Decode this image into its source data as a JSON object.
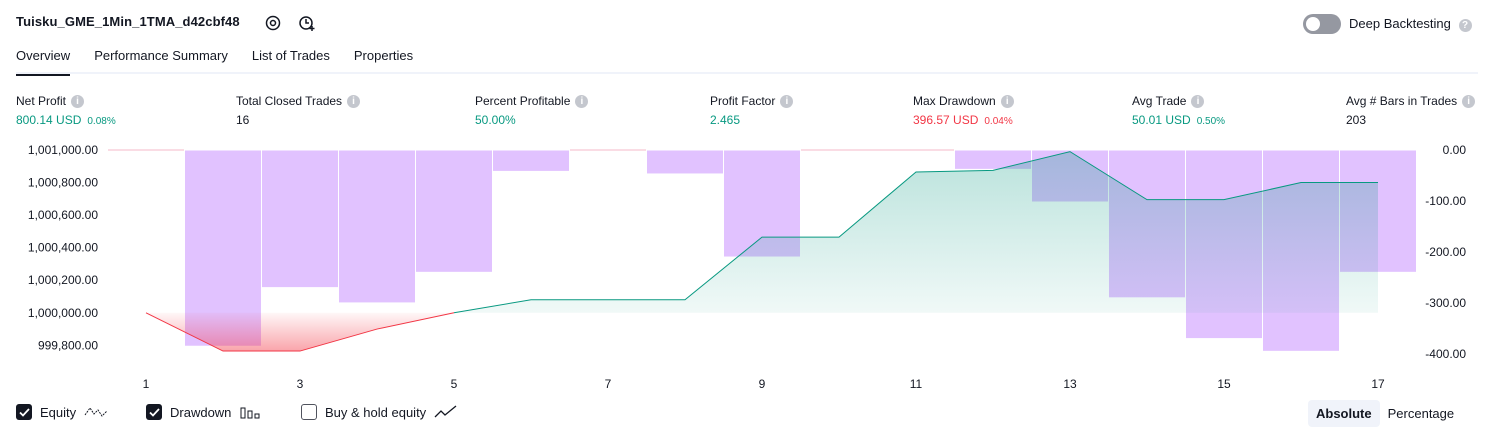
{
  "header": {
    "title": "Tuisku_GME_1Min_1TMA_d42cbf48",
    "deep_backtesting_label": "Deep Backtesting"
  },
  "tabs": [
    "Overview",
    "Performance Summary",
    "List of Trades",
    "Properties"
  ],
  "metrics": {
    "net_profit": {
      "label": "Net Profit",
      "value": "800.14 USD",
      "pct": "0.08%"
    },
    "total_closed_trades": {
      "label": "Total Closed Trades",
      "value": "16"
    },
    "percent_profitable": {
      "label": "Percent Profitable",
      "value": "50.00%"
    },
    "profit_factor": {
      "label": "Profit Factor",
      "value": "2.465"
    },
    "max_drawdown": {
      "label": "Max Drawdown",
      "value": "396.57 USD",
      "pct": "0.04%"
    },
    "avg_trade": {
      "label": "Avg Trade",
      "value": "50.01 USD",
      "pct": "0.50%"
    },
    "avg_bars": {
      "label": "Avg # Bars in Trades",
      "value": "203"
    }
  },
  "legend": {
    "equity": "Equity",
    "drawdown": "Drawdown",
    "buy_hold": "Buy & hold equity"
  },
  "mode": {
    "absolute": "Absolute",
    "percentage": "Percentage"
  },
  "colors": {
    "green": "#089981",
    "red": "#f23645",
    "bar": "#d9b3ff"
  },
  "chart_data": {
    "type": "line",
    "left_axis_ticks": [
      "1,001,000.00",
      "1,000,800.00",
      "1,000,600.00",
      "1,000,400.00",
      "1,000,200.00",
      "1,000,000.00",
      "999,800.00"
    ],
    "right_axis_ticks": [
      "0.00",
      "-100.00",
      "-200.00",
      "-300.00",
      "-400.00"
    ],
    "x_ticks": [
      "1",
      "3",
      "5",
      "7",
      "9",
      "11",
      "13",
      "15",
      "17"
    ],
    "x": [
      1,
      2,
      3,
      4,
      5,
      6,
      7,
      8,
      9,
      10,
      11,
      12,
      13,
      14,
      15,
      16,
      17
    ],
    "series": [
      {
        "name": "Equity",
        "values": [
          1000000,
          999765,
          999765,
          999900,
          1000000,
          1000080,
          1000080,
          1000080,
          1000465,
          1000465,
          1000865,
          1000875,
          1000990,
          1000695,
          1000695,
          1000800,
          1000800
        ]
      },
      {
        "name": "Drawdown",
        "values": [
          null,
          -385,
          -270,
          -300,
          -240,
          -42,
          null,
          -47,
          -210,
          null,
          null,
          -38,
          -102,
          -290,
          -370,
          -395,
          -240
        ]
      }
    ],
    "equity_ylim": [
      999710,
      1001000
    ],
    "drawdown_ylim": [
      -412,
      0
    ]
  }
}
